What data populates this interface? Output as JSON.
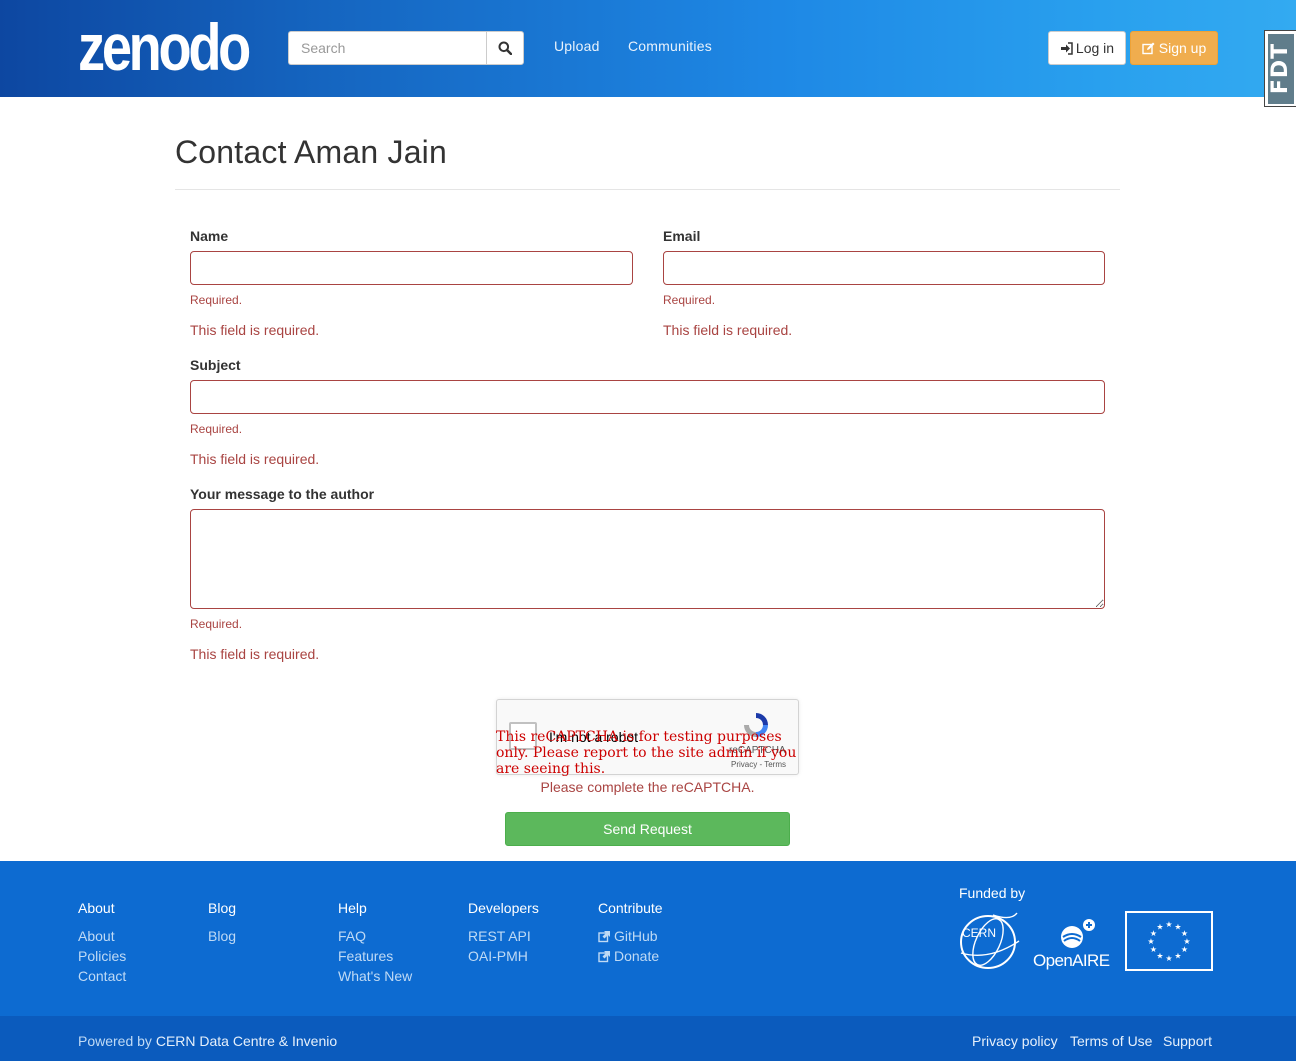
{
  "header": {
    "brand": "zenodo",
    "search": {
      "placeholder": "Search",
      "value": ""
    },
    "nav": [
      "Upload",
      "Communities"
    ],
    "login_label": "Log in",
    "signup_label": "Sign up",
    "badge_text": "FDT"
  },
  "page": {
    "title": "Contact Aman Jain"
  },
  "form": {
    "name": {
      "label": "Name",
      "hint": "Required.",
      "error": "This field is required.",
      "value": ""
    },
    "email": {
      "label": "Email",
      "hint": "Required.",
      "error": "This field is required.",
      "value": ""
    },
    "subject": {
      "label": "Subject",
      "hint": "Required.",
      "error": "This field is required.",
      "value": ""
    },
    "message": {
      "label": "Your message to the author",
      "hint": "Required.",
      "error": "This field is required.",
      "value": ""
    },
    "recaptcha": {
      "label": "I'm not a robot",
      "brand": "reCAPTCHA",
      "privacy": "Privacy",
      "terms": "Terms",
      "warning": "This reCAPTCHA is for testing purposes only. Please report to the site admin if you are seeing this.",
      "error": "Please complete the reCAPTCHA."
    },
    "submit_label": "Send Request"
  },
  "footer": {
    "columns": [
      {
        "heading": "About",
        "links": [
          "About",
          "Policies",
          "Contact"
        ]
      },
      {
        "heading": "Blog",
        "links": [
          "Blog"
        ]
      },
      {
        "heading": "Help",
        "links": [
          "FAQ",
          "Features",
          "What's New"
        ]
      },
      {
        "heading": "Developers",
        "links": [
          "REST API",
          "OAI-PMH"
        ]
      },
      {
        "heading": "Contribute",
        "links": [
          "GitHub",
          "Donate"
        ]
      }
    ],
    "funded_by": "Funded by",
    "cern_label": "CERN",
    "openaire_label": "OpenAIRE",
    "powered_prefix": "Powered by",
    "powered_by": "CERN Data Centre & Invenio",
    "bottom_links": [
      "Privacy policy",
      "Terms of Use",
      "Support"
    ]
  },
  "colors": {
    "header_start": "#0d47a1",
    "header_end": "#33aaf1",
    "error": "#a94442",
    "success": "#5cb85c",
    "warning": "#f0ad4e",
    "footer": "#0d6bd1"
  }
}
